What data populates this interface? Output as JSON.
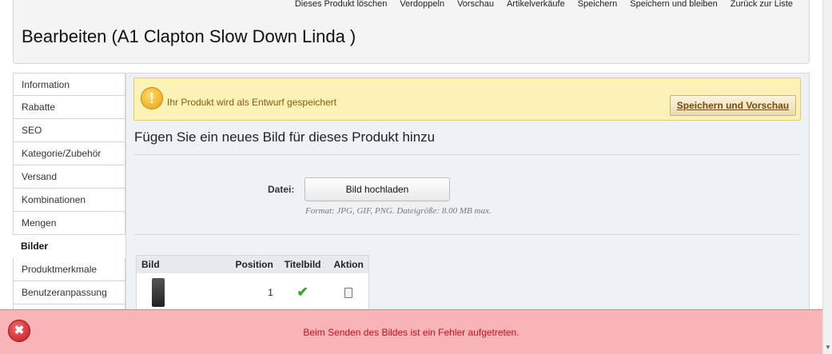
{
  "toolbar": {
    "buttons": [
      {
        "label": "Dieses Produkt löschen"
      },
      {
        "label": "Verdoppeln"
      },
      {
        "label": "Vorschau"
      },
      {
        "label": "Artikelverkäufe"
      },
      {
        "label": "Speichern"
      },
      {
        "label": "Speichern und bleiben"
      },
      {
        "label": "Zurück zur Liste"
      }
    ]
  },
  "header": {
    "title": "Bearbeiten (A1 Clapton Slow Down Linda )"
  },
  "sidebar": {
    "tabs": [
      {
        "label": "Information"
      },
      {
        "label": "Rabatte"
      },
      {
        "label": "SEO"
      },
      {
        "label": "Kategorie/Zubehör"
      },
      {
        "label": "Versand"
      },
      {
        "label": "Kombinationen"
      },
      {
        "label": "Mengen"
      },
      {
        "label": "Bilder"
      },
      {
        "label": "Produktmerkmale"
      },
      {
        "label": "Benutzeranpassung"
      }
    ],
    "active": "Bilder"
  },
  "warning": {
    "icon": "warning-icon",
    "icon_glyph": "!",
    "text": "Ihr Produkt wird als Entwurf gespeichert",
    "button_label": "Speichern und Vorschau"
  },
  "images_section": {
    "title": "Fügen Sie ein neues Bild für dieses Produkt hinzu",
    "file_label": "Datei:",
    "upload_button": "Bild hochladen",
    "hint": "Format: JPG, GIF, PNG. Dateigröße: 8.00 MB max."
  },
  "image_table": {
    "headers": [
      "Bild",
      "Position",
      "Titelbild",
      "Aktion"
    ],
    "rows": [
      {
        "position": "1",
        "cover": "✔"
      }
    ]
  },
  "error": {
    "icon": "error-icon",
    "icon_glyph": "✖",
    "text": "Beim Senden des Bildes ist ein Fehler aufgetreten."
  },
  "colors": {
    "warning_bg": "#fcf2b6",
    "error_bg": "#f9b4b8",
    "error_text": "#c0131c",
    "check_green": "#3fa32d"
  }
}
